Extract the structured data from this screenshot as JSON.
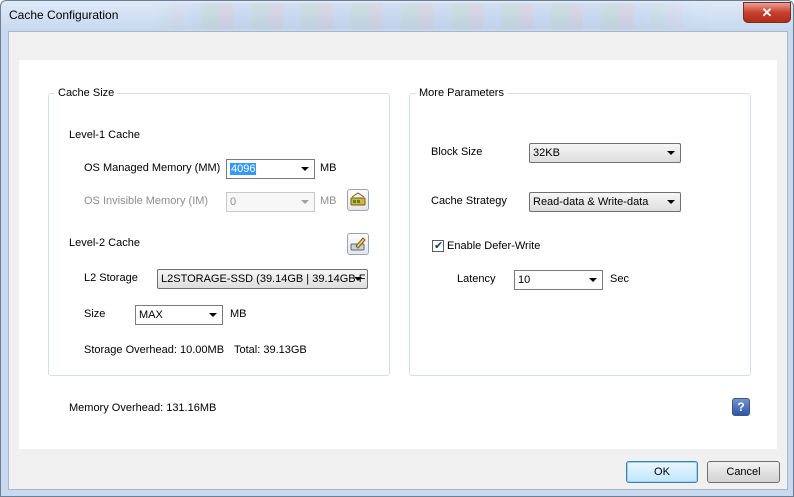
{
  "window": {
    "title": "Cache Configuration",
    "close_label": "✕"
  },
  "cache_size": {
    "title": "Cache Size",
    "level1_heading": "Level-1 Cache",
    "os_managed_label": "OS Managed Memory (MM)",
    "os_managed_value": "4096",
    "os_managed_unit": "MB",
    "os_invisible_label": "OS Invisible Memory (IM)",
    "os_invisible_value": "0",
    "os_invisible_unit": "MB",
    "level2_heading": "Level-2 Cache",
    "l2_storage_label": "L2 Storage",
    "l2_storage_value": "L2STORAGE-SSD (39.14GB | 39.14GB F",
    "size_label": "Size",
    "size_value": "MAX",
    "size_unit": "MB",
    "storage_overhead": "Storage Overhead: 10.00MB",
    "total": "Total: 39.13GB"
  },
  "more_parameters": {
    "title": "More Parameters",
    "block_size_label": "Block Size",
    "block_size_value": "32KB",
    "cache_strategy_label": "Cache Strategy",
    "cache_strategy_value": "Read-data & Write-data",
    "defer_write_label": "Enable Defer-Write",
    "defer_write_checked": true,
    "latency_label": "Latency",
    "latency_value": "10",
    "latency_unit": "Sec"
  },
  "memory_overhead": "Memory Overhead: 131.16MB",
  "help_label": "?",
  "buttons": {
    "ok": "OK",
    "cancel": "Cancel"
  },
  "colors": {
    "selection": "#3399ff",
    "title_gradient_top": "#dfeaf8",
    "close_button": "#c7402d"
  }
}
